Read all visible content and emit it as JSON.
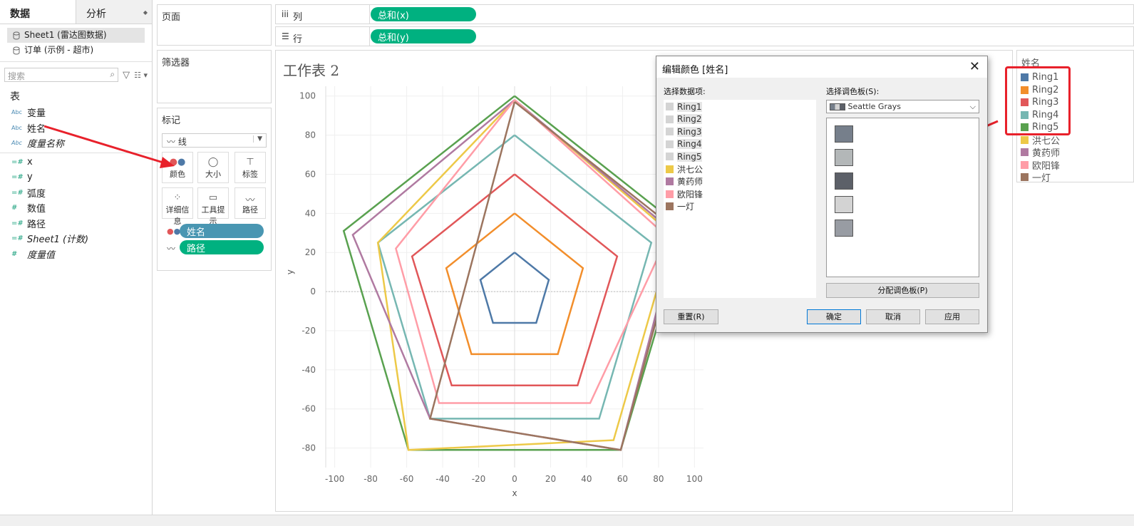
{
  "left_pane": {
    "tab_data": "数据",
    "tab_analysis": "分析",
    "datasources": [
      "Sheet1 (雷达图数据)",
      "订单 (示例 - 超市)"
    ],
    "search_placeholder": "搜索",
    "table_header": "表",
    "dimensions": [
      {
        "type": "Abc",
        "name": "变量",
        "italic": false
      },
      {
        "type": "Abc",
        "name": "姓名",
        "italic": false
      },
      {
        "type": "Abc",
        "name": "度量名称",
        "italic": true
      }
    ],
    "measures": [
      {
        "type": "=#",
        "name": "x",
        "italic": false
      },
      {
        "type": "=#",
        "name": "y",
        "italic": false
      },
      {
        "type": "=#",
        "name": "弧度",
        "italic": false
      },
      {
        "type": "#",
        "name": "数值",
        "italic": false
      },
      {
        "type": "=#",
        "name": "路径",
        "italic": false
      },
      {
        "type": "=#",
        "name": "Sheet1 (计数)",
        "italic": true
      },
      {
        "type": "#",
        "name": "度量值",
        "italic": true
      }
    ]
  },
  "shelves": {
    "pages_title": "页面",
    "filters_title": "筛选器",
    "marks_title": "标记",
    "mark_type": "线",
    "columns_label": "列",
    "rows_label": "行",
    "columns_pill": "总和(x)",
    "rows_pill": "总和(y)",
    "mark_buttons": [
      "颜色",
      "大小",
      "标签",
      "详细信息",
      "工具提示",
      "路径"
    ],
    "mark_pills": [
      {
        "label": "姓名",
        "color": "#4996b2"
      },
      {
        "label": "路径",
        "color": "#00b180"
      }
    ]
  },
  "sheet": {
    "title": "工作表 2",
    "xlabel": "x",
    "ylabel": "y"
  },
  "chart_data": {
    "type": "line",
    "title": "",
    "xlabel": "x",
    "ylabel": "y",
    "xlim": [
      -105,
      105
    ],
    "ylim": [
      -90,
      105
    ],
    "x_ticks": [
      -100,
      -80,
      -60,
      -40,
      -20,
      0,
      20,
      40,
      60,
      80,
      100
    ],
    "y_ticks": [
      100,
      80,
      60,
      40,
      20,
      0,
      -20,
      -40,
      -60,
      -80
    ],
    "grid": true,
    "series": [
      {
        "name": "Ring1",
        "color": "#4e79a7",
        "points": [
          [
            0,
            20
          ],
          [
            19,
            6
          ],
          [
            12,
            -16
          ],
          [
            -12,
            -16
          ],
          [
            -19,
            6
          ],
          [
            0,
            20
          ]
        ]
      },
      {
        "name": "Ring2",
        "color": "#f28e2b",
        "points": [
          [
            0,
            40
          ],
          [
            38,
            12
          ],
          [
            24,
            -32
          ],
          [
            -24,
            -32
          ],
          [
            -38,
            12
          ],
          [
            0,
            40
          ]
        ]
      },
      {
        "name": "Ring3",
        "color": "#e15759",
        "points": [
          [
            0,
            60
          ],
          [
            57,
            18
          ],
          [
            35,
            -48
          ],
          [
            -35,
            -48
          ],
          [
            -57,
            18
          ],
          [
            0,
            60
          ]
        ]
      },
      {
        "name": "Ring4",
        "color": "#76b7b2",
        "points": [
          [
            0,
            80
          ],
          [
            76,
            25
          ],
          [
            47,
            -65
          ],
          [
            -47,
            -65
          ],
          [
            -76,
            25
          ],
          [
            0,
            80
          ]
        ]
      },
      {
        "name": "Ring5",
        "color": "#59a14f",
        "points": [
          [
            0,
            100
          ],
          [
            95,
            31
          ],
          [
            59,
            -81
          ],
          [
            -59,
            -81
          ],
          [
            -95,
            31
          ],
          [
            0,
            100
          ]
        ]
      },
      {
        "name": "洪七公",
        "color": "#edc948",
        "points": [
          [
            0,
            98
          ],
          [
            88,
            29
          ],
          [
            55,
            -76
          ],
          [
            -59,
            -81
          ],
          [
            -76,
            25
          ],
          [
            0,
            98
          ]
        ]
      },
      {
        "name": "黄药师",
        "color": "#b07aa1",
        "points": [
          [
            0,
            98
          ],
          [
            90,
            29
          ],
          [
            59,
            -81
          ],
          [
            -47,
            -65
          ],
          [
            -90,
            29
          ],
          [
            0,
            98
          ]
        ]
      },
      {
        "name": "欧阳锋",
        "color": "#ff9da7",
        "points": [
          [
            0,
            98
          ],
          [
            85,
            28
          ],
          [
            42,
            -57
          ],
          [
            -42,
            -57
          ],
          [
            -66,
            22
          ],
          [
            0,
            98
          ]
        ]
      },
      {
        "name": "一灯",
        "color": "#9c755f",
        "points": [
          [
            0,
            97
          ],
          [
            92,
            30
          ],
          [
            59,
            -81
          ],
          [
            -47,
            -65
          ],
          [
            0,
            97
          ]
        ]
      }
    ]
  },
  "legend": {
    "title": "姓名",
    "items": [
      {
        "label": "Ring1",
        "color": "#4e79a7"
      },
      {
        "label": "Ring2",
        "color": "#f28e2b"
      },
      {
        "label": "Ring3",
        "color": "#e15759"
      },
      {
        "label": "Ring4",
        "color": "#76b7b2"
      },
      {
        "label": "Ring5",
        "color": "#59a14f"
      },
      {
        "label": "洪七公",
        "color": "#edc948"
      },
      {
        "label": "黄药师",
        "color": "#b07aa1"
      },
      {
        "label": "欧阳锋",
        "color": "#ff9da7"
      },
      {
        "label": "一灯",
        "color": "#9c755f"
      }
    ],
    "highlight_color": "#e8212b"
  },
  "dialog": {
    "title": "编辑颜色 [姓名]",
    "data_items_label": "选择数据项:",
    "palette_label": "选择调色板(S):",
    "palette_value": "Seattle Grays",
    "data_items": [
      {
        "label": "Ring1",
        "color": "#d4d4d4"
      },
      {
        "label": "Ring2",
        "color": "#d4d4d4"
      },
      {
        "label": "Ring3",
        "color": "#d4d4d4"
      },
      {
        "label": "Ring4",
        "color": "#d4d4d4"
      },
      {
        "label": "Ring5",
        "color": "#d4d4d4"
      },
      {
        "label": "洪七公",
        "color": "#edc948"
      },
      {
        "label": "黄药师",
        "color": "#b07aa1"
      },
      {
        "label": "欧阳锋",
        "color": "#ff9da7"
      },
      {
        "label": "一灯",
        "color": "#9c755f"
      }
    ],
    "palette_swatches": [
      "#767f8b",
      "#b3b7b8",
      "#5c6068",
      "#d3d3d3",
      "#989ca3"
    ],
    "assign_button": "分配调色板(P)",
    "reset_button": "重置(R)",
    "ok_button": "确定",
    "cancel_button": "取消",
    "apply_button": "应用"
  }
}
